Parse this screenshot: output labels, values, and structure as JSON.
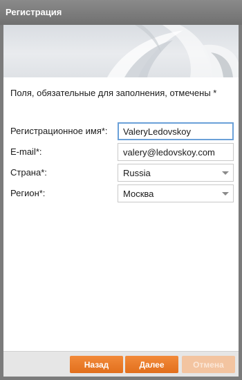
{
  "window": {
    "title": "Регистрация"
  },
  "banner": {
    "icon": "decorative-swoosh-graphic"
  },
  "form": {
    "required_note": "Поля, обязательные для заполнения, отмечены *",
    "username": {
      "label": "Регистрационное имя*:",
      "value": "ValeryLedovskoy"
    },
    "email": {
      "label": "E-mail*:",
      "value": "valery@ledovskoy.com"
    },
    "country": {
      "label": "Страна*:",
      "value": "Russia"
    },
    "region": {
      "label": "Регион*:",
      "value": "Москва"
    }
  },
  "footer": {
    "back_label": "Назад",
    "next_label": "Далее",
    "cancel_label": "Отмена"
  },
  "colors": {
    "accent": "#e87a26",
    "disabled_button": "#f3c4a0",
    "focus_border": "#6aa0d8",
    "titlebar": "#7b7b7b"
  }
}
